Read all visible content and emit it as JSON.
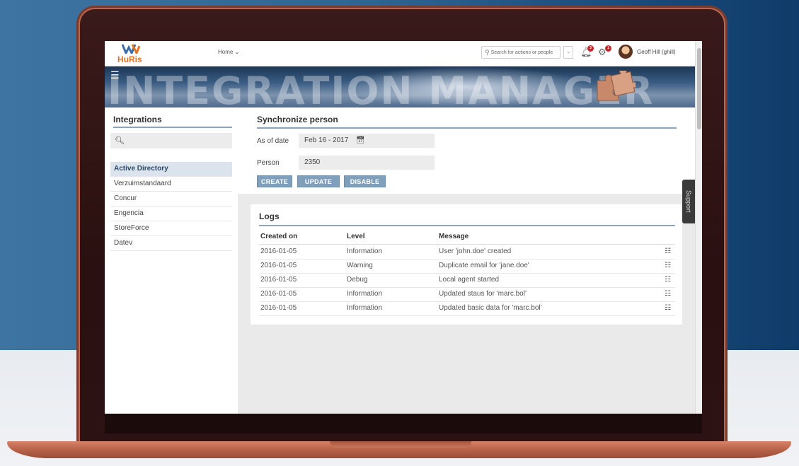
{
  "app": {
    "logo_text": "HuRis",
    "nav_home": "Home ⌄",
    "search_placeholder": "Search for actions or people",
    "notification_count": "3",
    "settings_count": "1",
    "user_name": "Geoff Hill (ghill)"
  },
  "banner": {
    "title": "INTEGRATION MANAGER"
  },
  "sidebar": {
    "title": "Integrations",
    "items": [
      {
        "label": "Active Directory",
        "active": true
      },
      {
        "label": "Verzuimstandaard"
      },
      {
        "label": "Concur"
      },
      {
        "label": "Engencia"
      },
      {
        "label": "StoreForce"
      },
      {
        "label": "Datev"
      }
    ]
  },
  "sync": {
    "title": "Synchronize person",
    "as_of_date_label": "As of date",
    "as_of_date_value": "Feb 16 - 2017",
    "person_label": "Person",
    "person_value": "2350",
    "buttons": {
      "create": "CREATE",
      "update": "UPDATE",
      "disable": "DISABLE"
    }
  },
  "logs": {
    "title": "Logs",
    "columns": [
      "Created on",
      "Level",
      "Message"
    ],
    "rows": [
      {
        "created": "2016-01-05",
        "level": "Information",
        "message": "User 'john.doe' created"
      },
      {
        "created": "2016-01-05",
        "level": "Warning",
        "message": "Duplicate email for 'jane.doe'"
      },
      {
        "created": "2016-01-05",
        "level": "Debug",
        "message": "Local agent started"
      },
      {
        "created": "2016-01-05",
        "level": "Information",
        "message": "Updated staus for 'marc.bol'"
      },
      {
        "created": "2016-01-05",
        "level": "Information",
        "message": "Updated basic data for 'marc.bol'"
      }
    ]
  },
  "support_tab": "Support",
  "colors": {
    "accent": "#7f9fba",
    "brand_orange": "#e8711e",
    "badge_red": "#c62828"
  }
}
